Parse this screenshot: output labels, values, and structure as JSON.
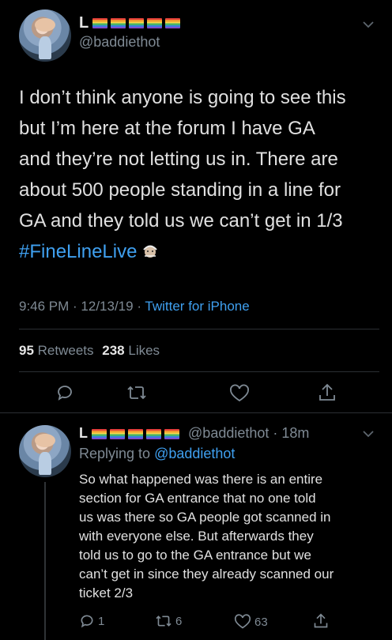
{
  "tweet": {
    "name_initial": "L",
    "handle": "@baddiethot",
    "text_lines": [
      "I don’t think anyone is going to see this",
      "but I’m here at the forum I have GA",
      "and they’re not letting us in. There are",
      "about 500 people standing in a line for",
      "GA and they told us we can’t get in 1/3"
    ],
    "hashtag": "#FineLineLive",
    "time_date": "9:46 PM · 12/13/19 ·",
    "source": "Twitter for iPhone",
    "retweets_count": "95",
    "retweets_label": "Retweets",
    "likes_count": "238",
    "likes_label": "Likes"
  },
  "reply": {
    "name_initial": "L",
    "handle_time": "@baddiethot · 18m",
    "replying_label": "Replying to",
    "replying_handle": "@baddiethot",
    "text_lines": [
      "So what happened was there is an entire",
      "section for GA entrance that no one told",
      "us was there so GA people got scanned in",
      "with everyone else. But afterwards they",
      "told us to go to the GA entrance but we",
      "can’t get in since they already scanned our",
      "ticket 2/3"
    ],
    "reply_count": "1",
    "retweet_count": "6",
    "like_count": "63"
  },
  "colors": {
    "background": "#000000",
    "text": "#d9d9d9",
    "secondary": "#7f8a94",
    "link": "#3fa0f0"
  }
}
